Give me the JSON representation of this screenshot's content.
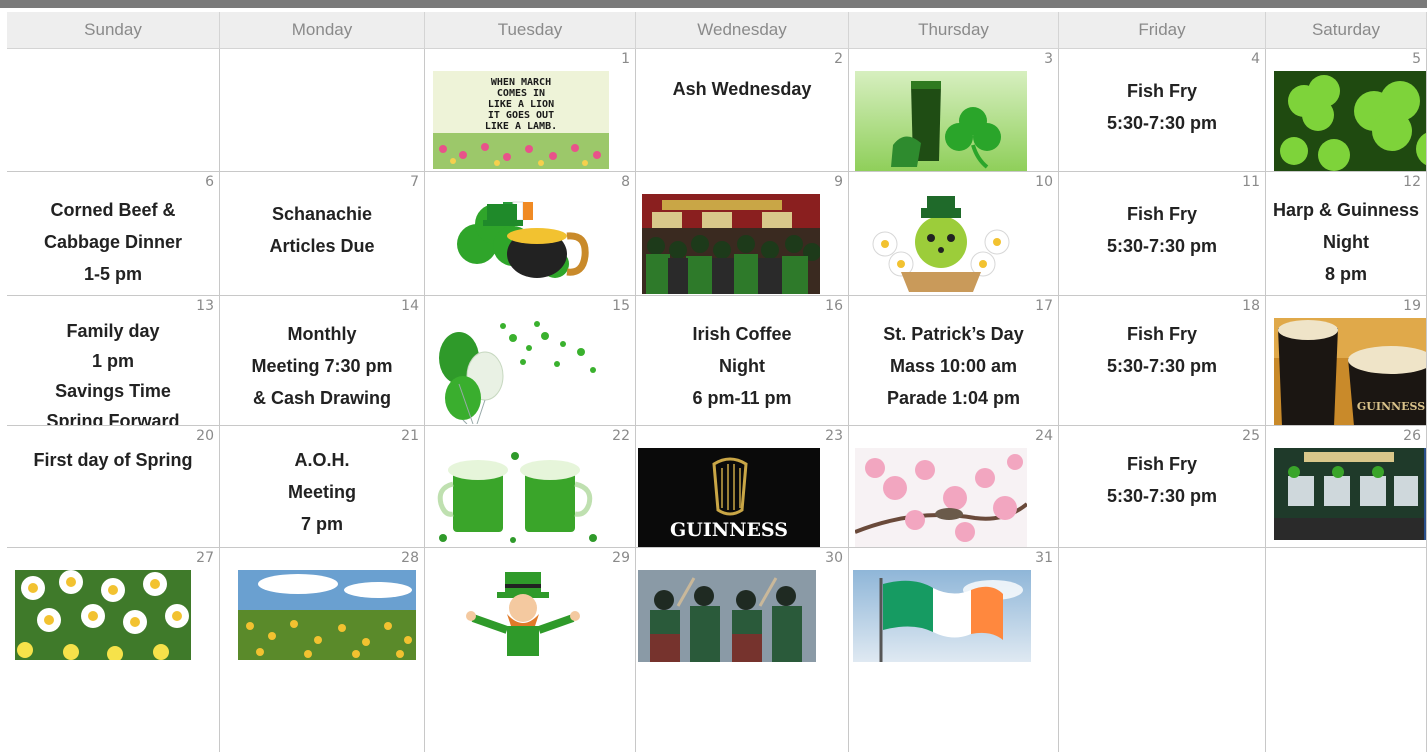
{
  "days": [
    "Sunday",
    "Monday",
    "Tuesday",
    "Wednesday",
    "Thursday",
    "Friday",
    "Saturday"
  ],
  "poster_text": [
    "WHEN MARCH",
    "COMES IN",
    "LIKE A LION",
    "IT GOES OUT",
    "LIKE A LAMB."
  ],
  "guinness_brand": "GUINNESS",
  "glass_brand": "GUINNESS",
  "events": {
    "d2": [
      "Ash Wednesday"
    ],
    "d4": [
      "Fish Fry",
      "5:30-7:30 pm"
    ],
    "d6": [
      "Corned Beef &",
      "Cabbage Dinner",
      "1-5 pm"
    ],
    "d7": [
      "Schanachie",
      "Articles Due"
    ],
    "d11": [
      "Fish Fry",
      "5:30-7:30 pm"
    ],
    "d12": [
      "Harp & Guinness",
      "Night",
      "8 pm"
    ],
    "d13": [
      "Family day",
      "1 pm",
      "Savings Time",
      "Spring Forward"
    ],
    "d14": [
      "Monthly",
      "Meeting 7:30 pm",
      "& Cash Drawing"
    ],
    "d16": [
      "Irish Coffee",
      "Night",
      "6 pm-11 pm"
    ],
    "d17": [
      "St. Patrick’s Day",
      "Mass 10:00 am",
      "Parade 1:04 pm"
    ],
    "d18": [
      "Fish Fry",
      "5:30-7:30 pm"
    ],
    "d20": [
      "First day of Spring"
    ],
    "d21": [
      "A.O.H.",
      "Meeting",
      "7 pm"
    ],
    "d25": [
      "Fish Fry",
      "5:30-7:30 pm"
    ]
  },
  "colors": {
    "header_bg": "#eeeeee",
    "grid_line": "#c8c8c8",
    "event_text": "#222222",
    "shamrock": "#3aa52a"
  }
}
